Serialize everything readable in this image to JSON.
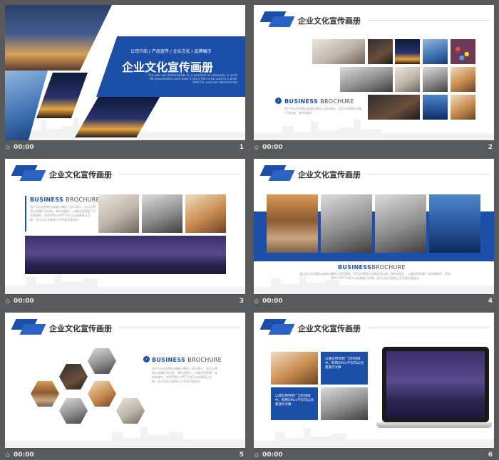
{
  "slides": [
    {
      "number": "1",
      "duration": "00:00",
      "nav": "公司介绍 / 产品宣传 / 企业文化 / 品牌展示",
      "title": "企业文化宣传画册",
      "subtitle": "The user can demonstrate on a projector or computer, or print the presentation and make it into a film to be used in a wider field.The user can demonstrate"
    },
    {
      "number": "2",
      "duration": "00:00",
      "title": "企业文化宣传画册",
      "brochure_a": "BUSINESS",
      "brochure_b": "BROCHURE",
      "body": "用户可以在投影仪或者计算机上进行演示，也可以将演示文稿打印出来，制作成胶片"
    },
    {
      "number": "3",
      "duration": "00:00",
      "title": "企业文化宣传画册",
      "brochure_a": "BUSINESS",
      "brochure_b": "BROCHURE",
      "body": "用户可以在投影仪或者计算机上进行演示，也可以将演示文稿打印出来，制作成胶片，以便应用到更广泛的领域中。利用Office PPT不仅可以创建演示文稿，还可以在互联网上召开面对面会议"
    },
    {
      "number": "4",
      "duration": "00:00",
      "title": "企业文化宣传画册",
      "brochure_a": "BUSINESS",
      "brochure_b": "BROCHURE",
      "body": "用户可以在投影仪或者计算机上进行演示，也可以将演示文稿打印出来，制作成胶片，以便应用到更广泛的领域中。利用Office PPT不仅可以创建演示文稿，还可以在互联网上召开面对面会议"
    },
    {
      "number": "5",
      "duration": "00:00",
      "title": "企业文化宣传画册",
      "brochure_a": "BUSINESS",
      "brochure_b": "BROCHURE",
      "body": "用户可以在投影仪或者计算机上进行演示，也可以将演示文稿打印出来，制作成胶片，以便应用到更广泛的领域中。利用Office PPT不仅可以创建演示文稿，还可以在互联网上召开面对面会议"
    },
    {
      "number": "6",
      "duration": "00:00",
      "title": "企业文化宣传画册",
      "box1": "以便应用到更广泛的领域中。利用Office不仅可以创建演示文稿",
      "box2": "以便应用到更广泛的领域中。利用Office不仅可以创建演示文稿"
    }
  ],
  "colors": {
    "brand": "#1b4fa8",
    "background": "#58595b"
  }
}
